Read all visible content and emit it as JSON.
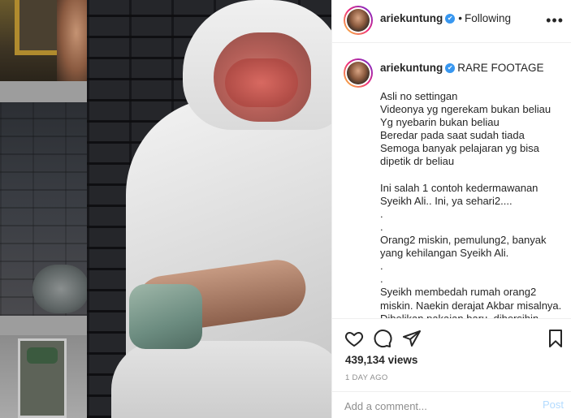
{
  "post": {
    "username": "ariekuntung",
    "following_label": "Following",
    "dot": "•",
    "caption_title": "RARE FOOTAGE",
    "caption_body": "Asli no settingan\nVideonya yg ngerekam bukan beliau\nYg nyebarin bukan beliau\nBeredar pada saat sudah tiada\nSemoga banyak pelajaran yg bisa dipetik dr beliau\n\nIni salah 1 contoh kedermawanan Syeikh Ali.. Ini, ya sehari2....\n.\n.\nOrang2 miskin, pemulung2, banyak yang kehilangan Syeikh Ali.\n.\n.\nSyeikh membedah rumah orang2 miskin. Naekin derajat Akbar misalnya. Dibelikan pakaian baru, dibersihin",
    "views_count": "439,134",
    "views_label": "views",
    "time_ago": "1 DAY AGO"
  },
  "comment_box": {
    "placeholder": "Add a comment...",
    "post_label": "Post"
  },
  "icons": {
    "more": "more-options-icon",
    "like": "heart-icon",
    "comment": "comment-icon",
    "share": "send-icon",
    "save": "bookmark-icon",
    "verified": "verified-badge-icon"
  },
  "colors": {
    "verified_blue": "#3897f0",
    "muted_gray": "#8e8e8e",
    "post_disabled": "#b3dbff"
  }
}
